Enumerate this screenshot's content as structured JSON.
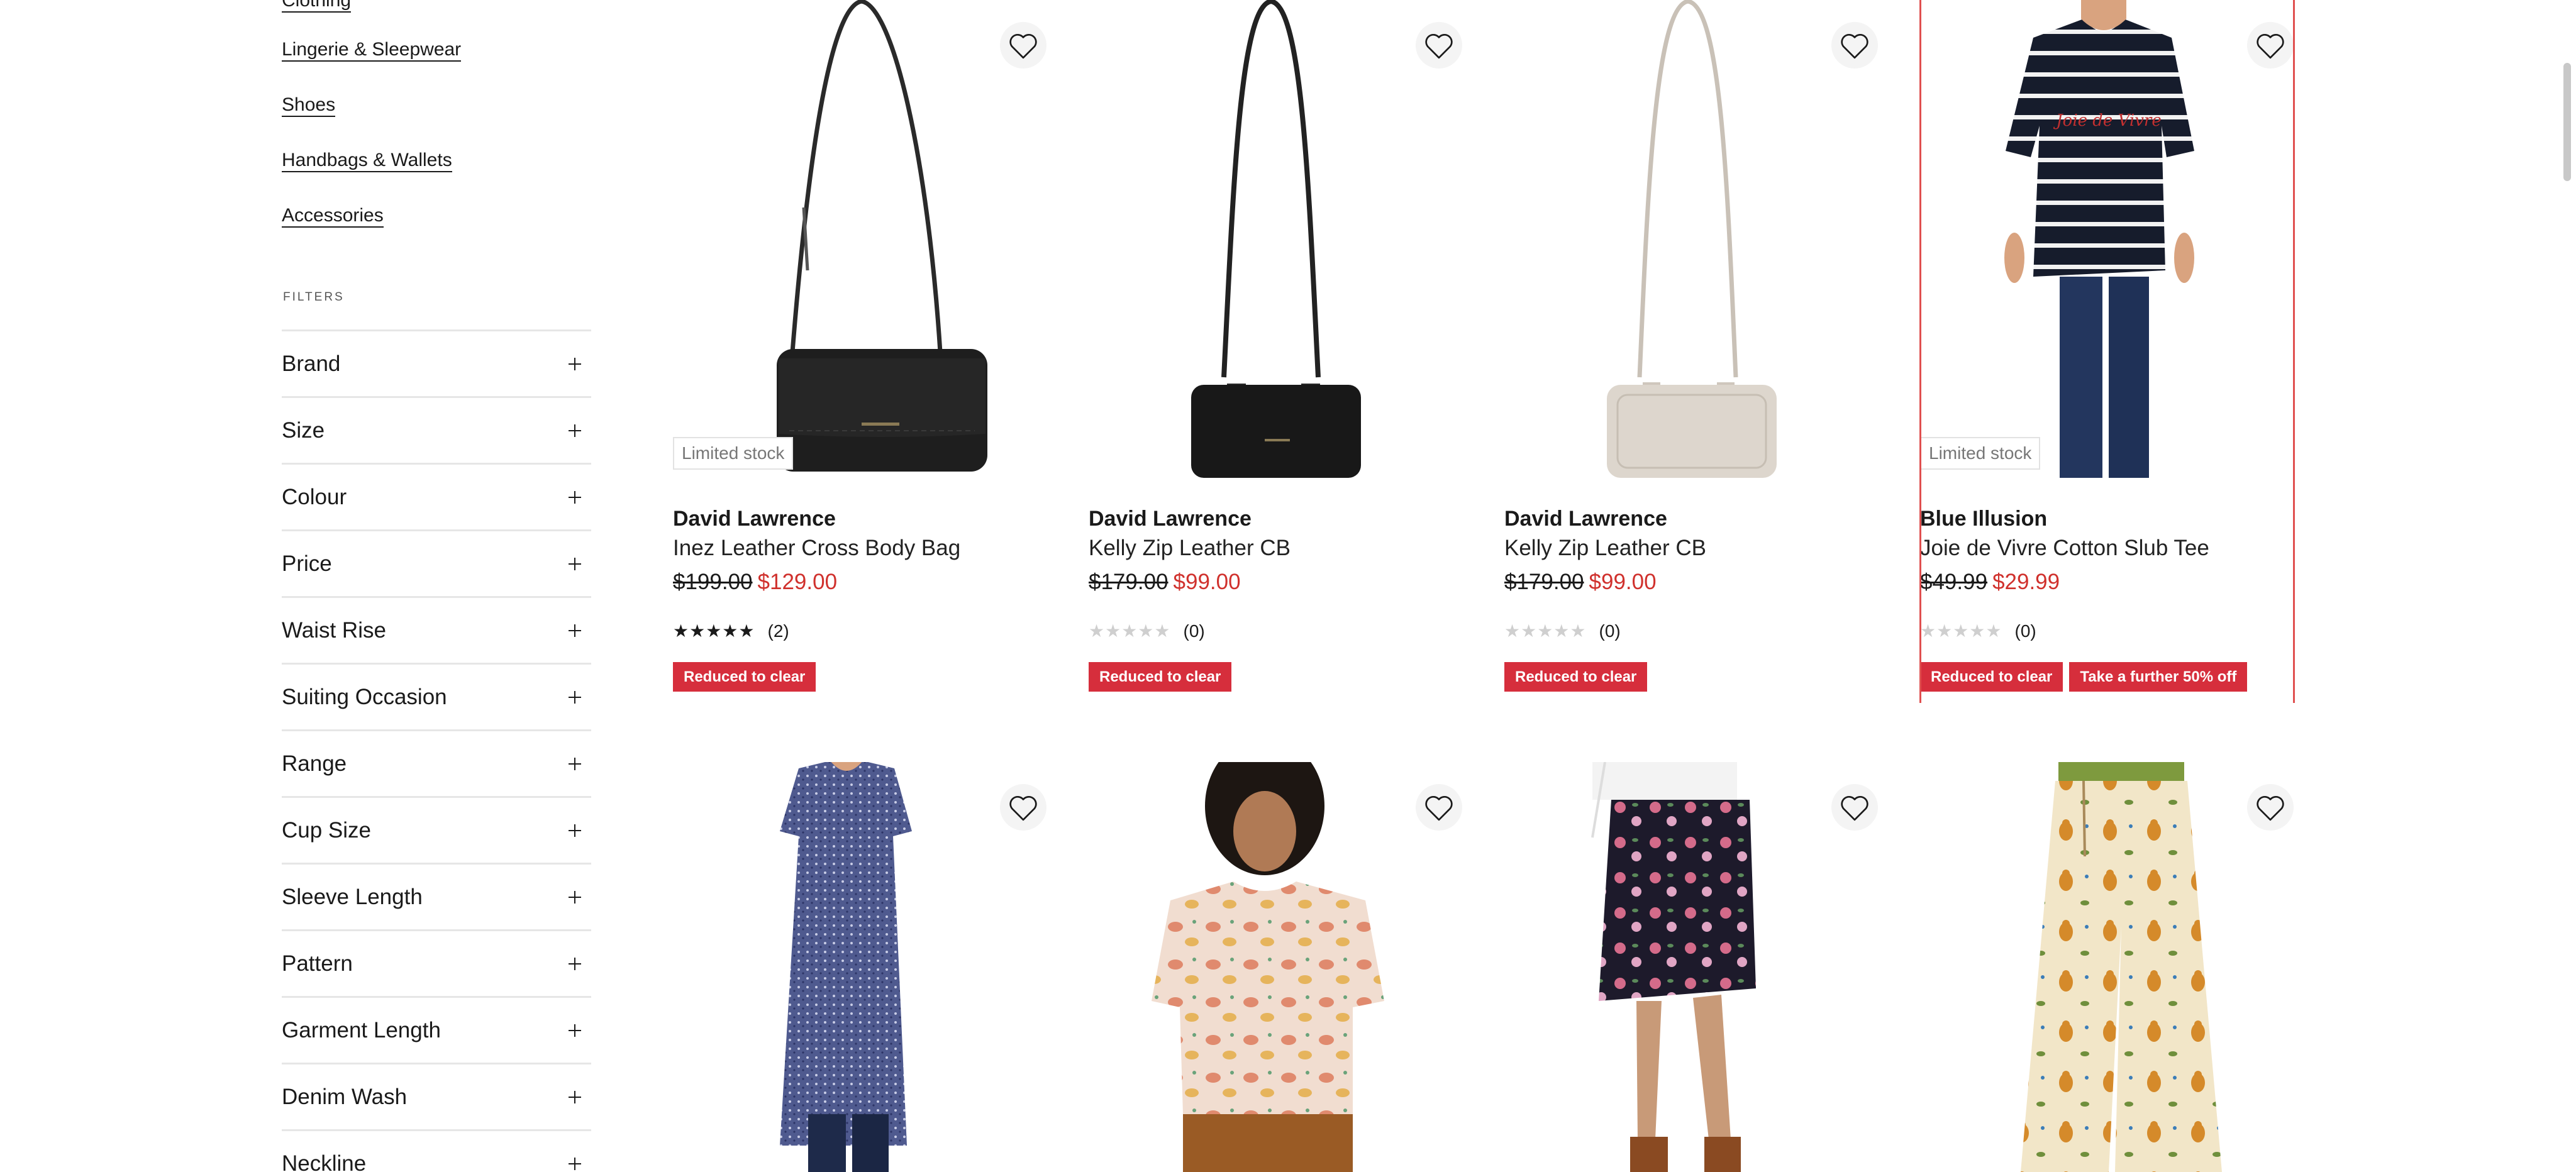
{
  "sidebar": {
    "categories": [
      "Clothing",
      "Lingerie & Sleepwear",
      "Shoes",
      "Handbags & Wallets",
      "Accessories"
    ],
    "filters_heading": "FILTERS",
    "filters": [
      "Brand",
      "Size",
      "Colour",
      "Price",
      "Waist Rise",
      "Suiting Occasion",
      "Range",
      "Cup Size",
      "Sleeve Length",
      "Pattern",
      "Garment Length",
      "Denim Wash",
      "Neckline"
    ]
  },
  "products": [
    {
      "stock_badge": "Limited stock",
      "brand": "David Lawrence",
      "name": "Inez Leather Cross Body Bag",
      "was_price": "$199.00",
      "now_price": "$129.00",
      "rating": 5,
      "review_count": "(2)",
      "tags": [
        "Reduced to clear"
      ]
    },
    {
      "stock_badge": "",
      "brand": "David Lawrence",
      "name": "Kelly Zip Leather CB",
      "was_price": "$179.00",
      "now_price": "$99.00",
      "rating": 0,
      "review_count": "(0)",
      "tags": [
        "Reduced to clear"
      ]
    },
    {
      "stock_badge": "",
      "brand": "David Lawrence",
      "name": "Kelly Zip Leather CB",
      "was_price": "$179.00",
      "now_price": "$99.00",
      "rating": 0,
      "review_count": "(0)",
      "tags": [
        "Reduced to clear"
      ]
    },
    {
      "stock_badge": "Limited stock",
      "brand": "Blue Illusion",
      "name": "Joie de Vivre Cotton Slub Tee",
      "was_price": "$49.99",
      "now_price": "$29.99",
      "rating": 0,
      "review_count": "(0)",
      "tags": [
        "Reduced to clear",
        "Take a further 50% off"
      ]
    }
  ],
  "colors": {
    "sale_price": "#d0312d",
    "tag_background": "#d62e3c",
    "highlight_border": "#e05050",
    "filter_divider": "#e6e6e6"
  },
  "icons": {
    "wishlist": "heart-outline-icon",
    "expand": "plus-icon"
  }
}
